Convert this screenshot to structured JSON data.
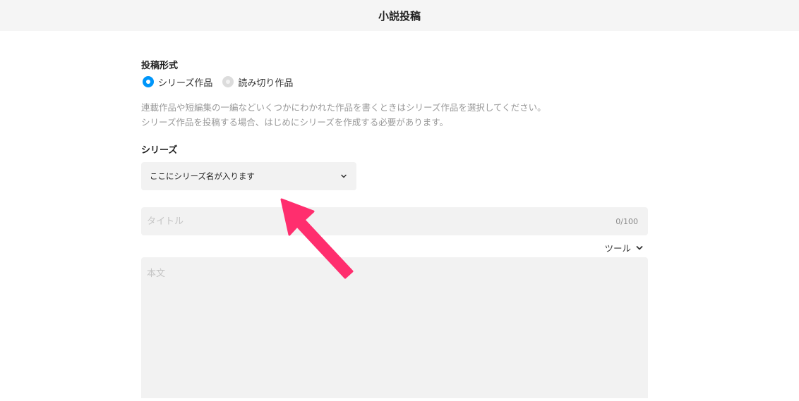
{
  "header": {
    "title": "小説投稿"
  },
  "form": {
    "post_format": {
      "label": "投稿形式",
      "options": [
        {
          "label": "シリーズ作品",
          "selected": true
        },
        {
          "label": "読み切り作品",
          "selected": false
        }
      ],
      "help_lines": [
        "連載作品や短編集の一編などいくつかにわかれた作品を書くときはシリーズ作品を選択してください。",
        "シリーズ作品を投稿する場合、はじめにシリーズを作成する必要があります。"
      ]
    },
    "series": {
      "label": "シリーズ",
      "selected_value": "ここにシリーズ名が入ります"
    },
    "title": {
      "placeholder": "タイトル",
      "counter": "0/100"
    },
    "tools": {
      "label": "ツール"
    },
    "body": {
      "placeholder": "本文"
    }
  },
  "colors": {
    "accent": "#0096fa",
    "annotation_arrow": "#ff2e6e",
    "field_bg": "#f2f2f2",
    "header_bg": "#f5f5f5"
  },
  "icons": {
    "select_chevron": "chevron-down-icon",
    "tools_chevron": "chevron-down-icon",
    "annotation": "arrow-annotation"
  }
}
